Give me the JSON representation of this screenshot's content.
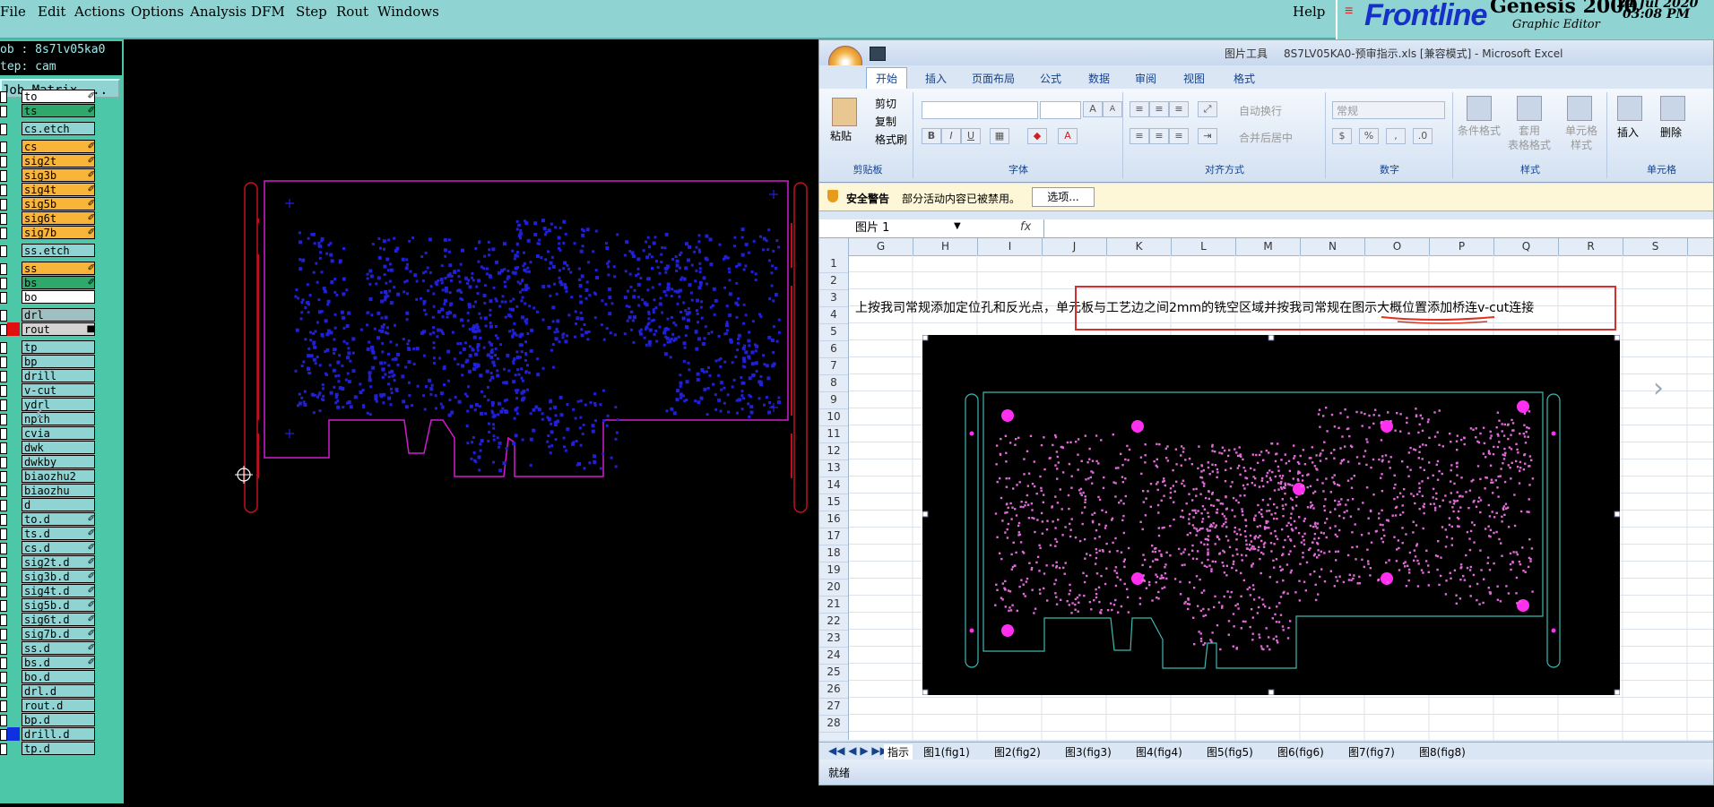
{
  "genesis": {
    "menus": [
      "File",
      "Edit",
      "Actions",
      "Options",
      "Analysis",
      "DFM",
      "Step",
      "Rout",
      "Windows"
    ],
    "help": "Help",
    "logo": {
      "brand": "Frontline",
      "product": "Genesis 2000",
      "subtitle": "Graphic Editor",
      "date": "24 Jul 2020",
      "time": "03:08 PM"
    },
    "job_label": "ob : 8s7lv05ka0",
    "step_label": "tep: cam",
    "matrix_button": "Job Matrix ...",
    "layers": [
      {
        "name": "to",
        "color": "#ffffff",
        "mark": "✐"
      },
      {
        "name": "ts",
        "color": "#2fa86b",
        "mark": "✐"
      },
      {
        "name": "cs.etch",
        "color": "#8fd3d3",
        "mark": ""
      },
      {
        "name": "cs",
        "color": "#f9b43a",
        "mark": "✐"
      },
      {
        "name": "sig2t",
        "color": "#f9b43a",
        "mark": "✐"
      },
      {
        "name": "sig3b",
        "color": "#f9b43a",
        "mark": "✐"
      },
      {
        "name": "sig4t",
        "color": "#f9b43a",
        "mark": "✐"
      },
      {
        "name": "sig5b",
        "color": "#f9b43a",
        "mark": "✐"
      },
      {
        "name": "sig6t",
        "color": "#f9b43a",
        "mark": "✐"
      },
      {
        "name": "sig7b",
        "color": "#f9b43a",
        "mark": "✐"
      },
      {
        "name": "ss.etch",
        "color": "#8fd3d3",
        "mark": ""
      },
      {
        "name": "ss",
        "color": "#f9b43a",
        "mark": "✐"
      },
      {
        "name": "bs",
        "color": "#2fa86b",
        "mark": "✐"
      },
      {
        "name": "bo",
        "color": "#ffffff",
        "mark": ""
      },
      {
        "name": "drl",
        "color": "#9ec0c0",
        "mark": ""
      },
      {
        "name": "rout",
        "color": "#d3d3d3",
        "mark": "■"
      },
      {
        "name": "tp",
        "color": "#8fd3d3",
        "mark": ""
      },
      {
        "name": "bp",
        "color": "#8fd3d3",
        "mark": ""
      },
      {
        "name": "drill",
        "color": "#8fd3d3",
        "mark": ""
      },
      {
        "name": "v-cut",
        "color": "#8fd3d3",
        "mark": ""
      },
      {
        "name": "ydrl",
        "color": "#8fd3d3",
        "mark": ""
      },
      {
        "name": "npth",
        "color": "#8fd3d3",
        "mark": ""
      },
      {
        "name": "cvia",
        "color": "#8fd3d3",
        "mark": ""
      },
      {
        "name": "dwk",
        "color": "#8fd3d3",
        "mark": ""
      },
      {
        "name": "dwkby",
        "color": "#8fd3d3",
        "mark": ""
      },
      {
        "name": "biaozhu2",
        "color": "#8fd3d3",
        "mark": ""
      },
      {
        "name": "biaozhu",
        "color": "#8fd3d3",
        "mark": ""
      },
      {
        "name": "d",
        "color": "#8fd3d3",
        "mark": ""
      },
      {
        "name": "to.d",
        "color": "#8fd3d3",
        "mark": "✐"
      },
      {
        "name": "ts.d",
        "color": "#8fd3d3",
        "mark": "✐"
      },
      {
        "name": "cs.d",
        "color": "#8fd3d3",
        "mark": "✐"
      },
      {
        "name": "sig2t.d",
        "color": "#8fd3d3",
        "mark": "✐"
      },
      {
        "name": "sig3b.d",
        "color": "#8fd3d3",
        "mark": "✐"
      },
      {
        "name": "sig4t.d",
        "color": "#8fd3d3",
        "mark": "✐"
      },
      {
        "name": "sig5b.d",
        "color": "#8fd3d3",
        "mark": "✐"
      },
      {
        "name": "sig6t.d",
        "color": "#8fd3d3",
        "mark": "✐"
      },
      {
        "name": "sig7b.d",
        "color": "#8fd3d3",
        "mark": "✐"
      },
      {
        "name": "ss.d",
        "color": "#8fd3d3",
        "mark": "✐"
      },
      {
        "name": "bs.d",
        "color": "#8fd3d3",
        "mark": "✐"
      },
      {
        "name": "bo.d",
        "color": "#8fd3d3",
        "mark": ""
      },
      {
        "name": "drl.d",
        "color": "#8fd3d3",
        "mark": ""
      },
      {
        "name": "rout.d",
        "color": "#8fd3d3",
        "mark": ""
      },
      {
        "name": "bp.d",
        "color": "#8fd3d3",
        "mark": ""
      },
      {
        "name": "drill.d",
        "color": "#8fd3d3",
        "mark": ""
      },
      {
        "name": "tp.d",
        "color": "#8fd3d3",
        "mark": ""
      }
    ],
    "board_outline_color": "#d01cd0",
    "pad_color": "#2020d8",
    "rail_color": "#c01020"
  },
  "excel": {
    "title_tool": "图片工具",
    "title": "8S7LV05KA0-预审指示.xls [兼容模式] - Microsoft Excel",
    "tabs": [
      "开始",
      "插入",
      "页面布局",
      "公式",
      "数据",
      "审阅",
      "视图",
      "格式"
    ],
    "clipboard": {
      "paste": "粘贴",
      "cut": "剪切",
      "copy": "复制",
      "format_painter": "格式刷",
      "label": "剪贴板"
    },
    "font_group": {
      "label": "字体",
      "bold": "B",
      "italic": "I",
      "underline": "U",
      "grow": "A",
      "shrink": "A"
    },
    "align_group": {
      "label": "对齐方式",
      "wrap": "自动换行",
      "merge": "合并后居中"
    },
    "number_group": {
      "label": "数字",
      "format": "常规",
      "percent": "%"
    },
    "styles_group": {
      "label": "样式",
      "cond": "条件格式",
      "table": "套用",
      "table2": "表格格式",
      "cell": "单元格",
      "cell2": "样式"
    },
    "cells_group": {
      "label": "单元格",
      "insert": "插入",
      "delete": "删除"
    },
    "security": {
      "title": "安全警告",
      "message": "部分活动内容已被禁用。",
      "options": "选项..."
    },
    "name_box": "图片 1",
    "fx": "fx",
    "columns": [
      "G",
      "H",
      "I",
      "J",
      "K",
      "L",
      "M",
      "N",
      "O",
      "P",
      "Q",
      "R",
      "S"
    ],
    "rows": [
      "1",
      "2",
      "3",
      "4",
      "5",
      "6",
      "7",
      "8",
      "9",
      "10",
      "11",
      "12",
      "13",
      "14",
      "15",
      "16",
      "17",
      "18",
      "19",
      "20",
      "21",
      "22",
      "23",
      "24",
      "25",
      "26",
      "27",
      "28"
    ],
    "note_text": "上按我司常规添加定位孔和反光点，单元板与工艺边之间2mm的铣空区域并按我司常规在图示大概位置添加桥连v-cut连接",
    "sheet_tabs": [
      "指示",
      "图1(fig1)",
      "图2(fig2)",
      "图3(fig3)",
      "图4(fig4)",
      "图5(fig5)",
      "图6(fig6)",
      "图7(fig7)",
      "图8(fig8)"
    ],
    "status": "就绪",
    "accent": "#15428b",
    "highlight_box_color": "#d32f2f"
  }
}
